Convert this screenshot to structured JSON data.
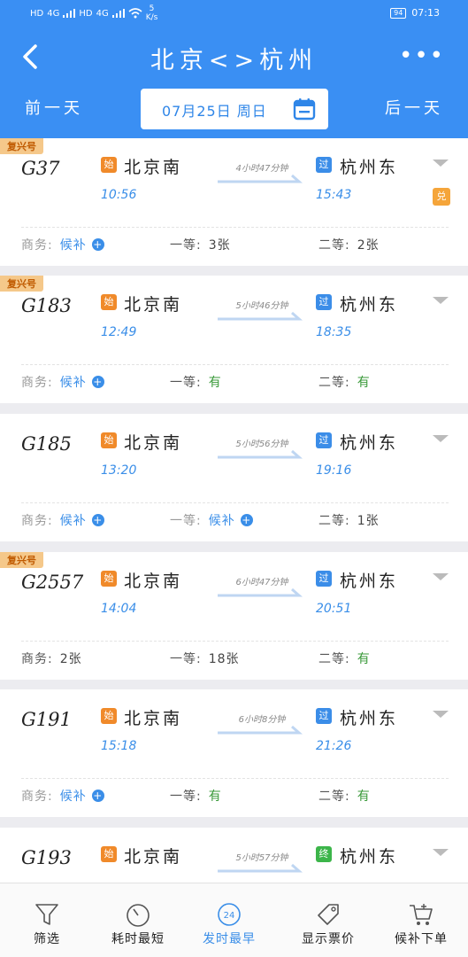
{
  "status_bar": {
    "hd1": "HD",
    "hd2": "HD",
    "net1": "4G",
    "net2": "4G",
    "speed_value": "5",
    "speed_unit": "K/s",
    "battery": "94",
    "time": "07:13"
  },
  "header": {
    "route_title": "北京<>杭州",
    "prev_day": "前一天",
    "next_day": "后一天",
    "date": "07月25日 周日"
  },
  "trains": [
    {
      "tag": "复兴号",
      "train_no": "G37",
      "from_badge": "始",
      "from": "北京南",
      "depart": "10:56",
      "duration": "4小时47分钟",
      "to_badge": "过",
      "to": "杭州东",
      "arrive": "15:43",
      "discount": "兑",
      "seats": [
        {
          "label": "商务:",
          "value": "候补",
          "type": "waitlist"
        },
        {
          "label": "一等:",
          "value": "3张",
          "type": "count"
        },
        {
          "label": "二等:",
          "value": "2张",
          "type": "count"
        }
      ]
    },
    {
      "tag": "复兴号",
      "train_no": "G183",
      "from_badge": "始",
      "from": "北京南",
      "depart": "12:49",
      "duration": "5小时46分钟",
      "to_badge": "过",
      "to": "杭州东",
      "arrive": "18:35",
      "seats": [
        {
          "label": "商务:",
          "value": "候补",
          "type": "waitlist"
        },
        {
          "label": "一等:",
          "value": "有",
          "type": "available"
        },
        {
          "label": "二等:",
          "value": "有",
          "type": "available"
        }
      ]
    },
    {
      "tag": "",
      "train_no": "G185",
      "from_badge": "始",
      "from": "北京南",
      "depart": "13:20",
      "duration": "5小时56分钟",
      "to_badge": "过",
      "to": "杭州东",
      "arrive": "19:16",
      "seats": [
        {
          "label": "商务:",
          "value": "候补",
          "type": "waitlist"
        },
        {
          "label": "一等:",
          "value": "候补",
          "type": "waitlist"
        },
        {
          "label": "二等:",
          "value": "1张",
          "type": "count"
        }
      ]
    },
    {
      "tag": "复兴号",
      "train_no": "G2557",
      "from_badge": "始",
      "from": "北京南",
      "depart": "14:04",
      "duration": "6小时47分钟",
      "to_badge": "过",
      "to": "杭州东",
      "arrive": "20:51",
      "seats": [
        {
          "label": "商务:",
          "value": "2张",
          "type": "count"
        },
        {
          "label": "一等:",
          "value": "18张",
          "type": "count"
        },
        {
          "label": "二等:",
          "value": "有",
          "type": "available"
        }
      ]
    },
    {
      "tag": "",
      "train_no": "G191",
      "from_badge": "始",
      "from": "北京南",
      "depart": "15:18",
      "duration": "6小时8分钟",
      "to_badge": "过",
      "to": "杭州东",
      "arrive": "21:26",
      "seats": [
        {
          "label": "商务:",
          "value": "候补",
          "type": "waitlist"
        },
        {
          "label": "一等:",
          "value": "有",
          "type": "available"
        },
        {
          "label": "二等:",
          "value": "有",
          "type": "available"
        }
      ]
    },
    {
      "tag": "",
      "train_no": "G193",
      "from_badge": "始",
      "from": "北京南",
      "depart": "",
      "duration": "5小时57分钟",
      "to_badge": "终",
      "to": "杭州东",
      "arrive": "",
      "seats": []
    }
  ],
  "bottom_nav": [
    {
      "label": "筛选",
      "icon": "filter-icon"
    },
    {
      "label": "耗时最短",
      "icon": "timer-icon"
    },
    {
      "label": "发时最早",
      "icon": "clock-24-icon",
      "active": true,
      "badge": "24"
    },
    {
      "label": "显示票价",
      "icon": "price-tag-icon"
    },
    {
      "label": "候补下单",
      "icon": "cart-icon"
    }
  ],
  "colors": {
    "primary": "#3a8ff3",
    "start_badge": "#f08a2a",
    "pass_badge": "#3b8de8",
    "end_badge": "#3cb54a",
    "available": "#3a9a3a",
    "fuxing_tag": "#f5c88a"
  }
}
